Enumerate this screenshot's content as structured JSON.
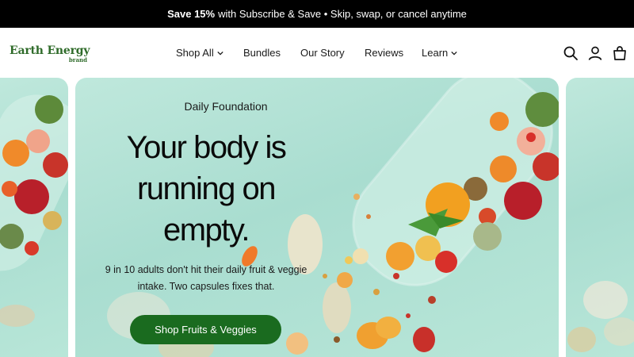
{
  "announcement": {
    "bold": "Save 15%",
    "text": "with Subscribe & Save • Skip, swap, or cancel anytime"
  },
  "brand": {
    "name": "Earth Energy",
    "sub": "brand",
    "color": "#2f6b2a"
  },
  "nav": {
    "items": [
      {
        "label": "Shop All",
        "has_dropdown": true
      },
      {
        "label": "Bundles",
        "has_dropdown": false
      },
      {
        "label": "Our Story",
        "has_dropdown": false
      },
      {
        "label": "Reviews",
        "has_dropdown": false
      },
      {
        "label": "Learn",
        "has_dropdown": true
      }
    ],
    "icons": [
      "search-icon",
      "account-icon",
      "cart-icon"
    ]
  },
  "hero": {
    "eyebrow": "Daily Foundation",
    "headline": "Your body is running on empty.",
    "subcopy": "9 in 10 adults don't hit their daily fruit & veggie intake. Two capsules fixes that.",
    "cta": "Shop Fruits & Veggies",
    "cta_color": "#1a6b1f"
  }
}
